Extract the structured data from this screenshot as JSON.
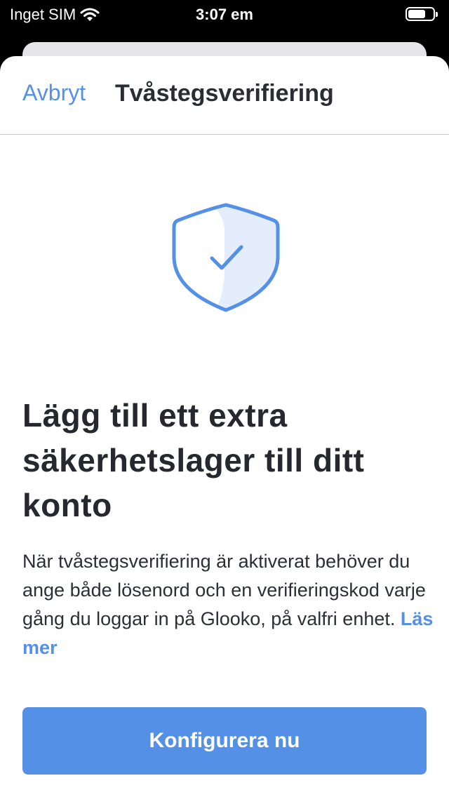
{
  "status_bar": {
    "carrier": "Inget SIM",
    "time": "3:07 em",
    "wifi_icon": "wifi-icon",
    "battery_icon": "battery-icon"
  },
  "nav": {
    "cancel_label": "Avbryt",
    "title": "Tvåstegsverifiering"
  },
  "hero": {
    "icon": "shield-check-icon"
  },
  "content": {
    "headline": "Lägg till ett extra säkerhetslager till ditt konto",
    "body": "När tvåstegsverifiering är aktiverat behöver du ange både lösenord och en verifieringskod varje gång du loggar in på Glooko, på valfri enhet.",
    "read_more_label": "Läs mer"
  },
  "actions": {
    "primary_label": "Konfigurera nu"
  },
  "colors": {
    "accent": "#5490e6",
    "shield_fill": "#e3edfb",
    "text_dark": "#25282e"
  }
}
